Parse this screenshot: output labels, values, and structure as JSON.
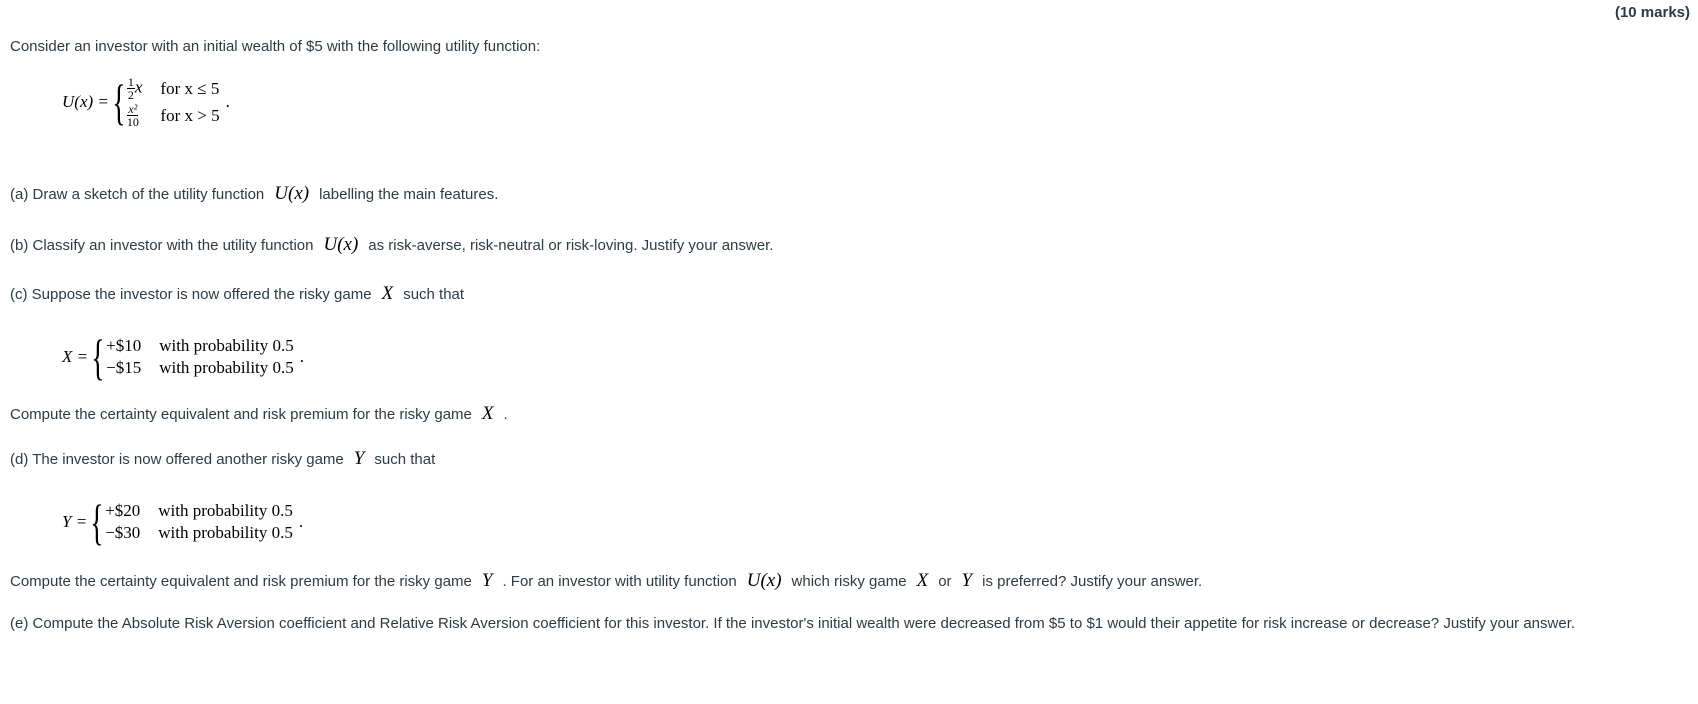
{
  "marks": "(10 marks)",
  "intro": "Consider an investor with an initial wealth of $5 with the following utility function:",
  "utility": {
    "lhs": "U(x) =",
    "cases": [
      {
        "num": "1",
        "den": "2",
        "var": "x",
        "cond": "for x ≤ 5"
      },
      {
        "num": "x²",
        "den": "10",
        "var": "",
        "cond": "for x > 5"
      }
    ],
    "trail": "."
  },
  "part_a": {
    "pre": "(a) Draw a sketch of the utility function",
    "math": "U(x)",
    "post": "labelling the main features."
  },
  "part_b": {
    "pre": "(b) Classify an investor with the utility function",
    "math": "U(x)",
    "post": "as risk-averse, risk-neutral or risk-loving. Justify your answer."
  },
  "part_c": {
    "pre": "(c) Suppose the investor is now offered the risky game",
    "math": "X",
    "post": "such that"
  },
  "game_x": {
    "lhs": "X =",
    "cases": [
      {
        "value": "+$10",
        "prob": "with probability 0.5"
      },
      {
        "value": "−$15",
        "prob": "with probability 0.5"
      }
    ],
    "trail": "."
  },
  "part_c_q": {
    "pre": "Compute the certainty equivalent and risk premium for the risky game",
    "math": "X",
    "post": "."
  },
  "part_d": {
    "pre": "(d) The investor is now offered another risky game",
    "math": "Y",
    "post": "such that"
  },
  "game_y": {
    "lhs": "Y =",
    "cases": [
      {
        "value": "+$20",
        "prob": "with probability 0.5"
      },
      {
        "value": "−$30",
        "prob": "with probability 0.5"
      }
    ],
    "trail": "."
  },
  "part_d_q": {
    "pre": "Compute the certainty equivalent and risk premium for the risky game",
    "math1": "Y",
    "mid": ". For an investor with utility function",
    "math2": "U(x)",
    "mid2": "which risky game",
    "math3": "X",
    "or": "or",
    "math4": "Y",
    "post": "is preferred? Justify your answer."
  },
  "part_e": "(e) Compute the Absolute Risk Aversion coefficient and Relative Risk Aversion coefficient for this investor. If the investor's initial wealth were decreased from $5 to $1 would their appetite for risk increase or decrease? Justify your answer."
}
